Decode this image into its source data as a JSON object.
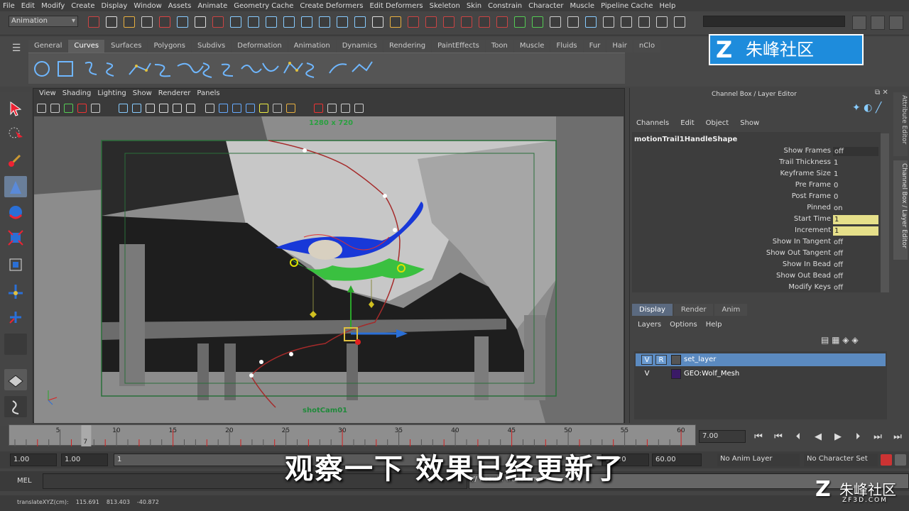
{
  "menu": [
    "File",
    "Edit",
    "Modify",
    "Create",
    "Display",
    "Window",
    "Assets",
    "Animate",
    "Geometry Cache",
    "Create Deformers",
    "Edit Deformers",
    "Skeleton",
    "Skin",
    "Constrain",
    "Character",
    "Muscle",
    "Pipeline Cache",
    "Help"
  ],
  "mode": "Animation",
  "shelf_tabs": [
    "General",
    "Curves",
    "Surfaces",
    "Polygons",
    "Subdivs",
    "Deformation",
    "Animation",
    "Dynamics",
    "Rendering",
    "PaintEffects",
    "Toon",
    "Muscle",
    "Fluids",
    "Fur",
    "Hair",
    "nClo"
  ],
  "watermark": "朱峰社区",
  "panel_menu": [
    "View",
    "Shading",
    "Lighting",
    "Show",
    "Renderer",
    "Panels"
  ],
  "resolution": "1280 x 720",
  "camera": "shotCam01",
  "channel_box": {
    "title": "Channel Box / Layer Editor",
    "menu": [
      "Channels",
      "Edit",
      "Object",
      "Show"
    ],
    "node": "motionTrail1HandleShape",
    "attrs": [
      {
        "name": "Show Frames",
        "value": "off"
      },
      {
        "name": "Trail Thickness",
        "value": "1"
      },
      {
        "name": "Keyframe Size",
        "value": "1"
      },
      {
        "name": "Pre Frame",
        "value": "0"
      },
      {
        "name": "Post Frame",
        "value": "0"
      },
      {
        "name": "Pinned",
        "value": "on"
      },
      {
        "name": "Start Time",
        "value": "1"
      },
      {
        "name": "Increment",
        "value": "1"
      },
      {
        "name": "Show In Tangent",
        "value": "off"
      },
      {
        "name": "Show Out Tangent",
        "value": "off"
      },
      {
        "name": "Show In Bead",
        "value": "off"
      },
      {
        "name": "Show Out Bead",
        "value": "off"
      },
      {
        "name": "Modify Keys",
        "value": "off"
      }
    ],
    "side_tabs": [
      "Attribute Editor",
      "Channel Box / Layer Editor"
    ]
  },
  "layer_editor": {
    "tabs": [
      "Display",
      "Render",
      "Anim"
    ],
    "menu": [
      "Layers",
      "Options",
      "Help"
    ],
    "layers": [
      {
        "v": "V",
        "r": "R",
        "name": "set_layer",
        "color": "#555555"
      },
      {
        "v": "V",
        "r": "",
        "name": "GEO:Wolf_Mesh",
        "color": "#3a1a66"
      }
    ]
  },
  "timeline": {
    "ticks": [
      "5",
      "10",
      "15",
      "20",
      "25",
      "30",
      "35",
      "40",
      "45",
      "50",
      "55",
      "60"
    ],
    "current": "7",
    "current_field": "7.00"
  },
  "range": {
    "start": "1.00",
    "start2": "1.00",
    "slider": "1",
    "end": "50.00",
    "end2": "60.00",
    "anim_layer": "No Anim Layer",
    "char_set": "No Character Set"
  },
  "cmd": {
    "label": "MEL",
    "result": "// Result: transform"
  },
  "help": {
    "label": "translateXYZ(cm):",
    "x": "115.691",
    "y": "813.403",
    "z": "-40.872"
  },
  "subtitle": "观察一下  效果已经更新了",
  "corner_logo": "朱峰社区",
  "corner_url": "ZF3D.COM"
}
